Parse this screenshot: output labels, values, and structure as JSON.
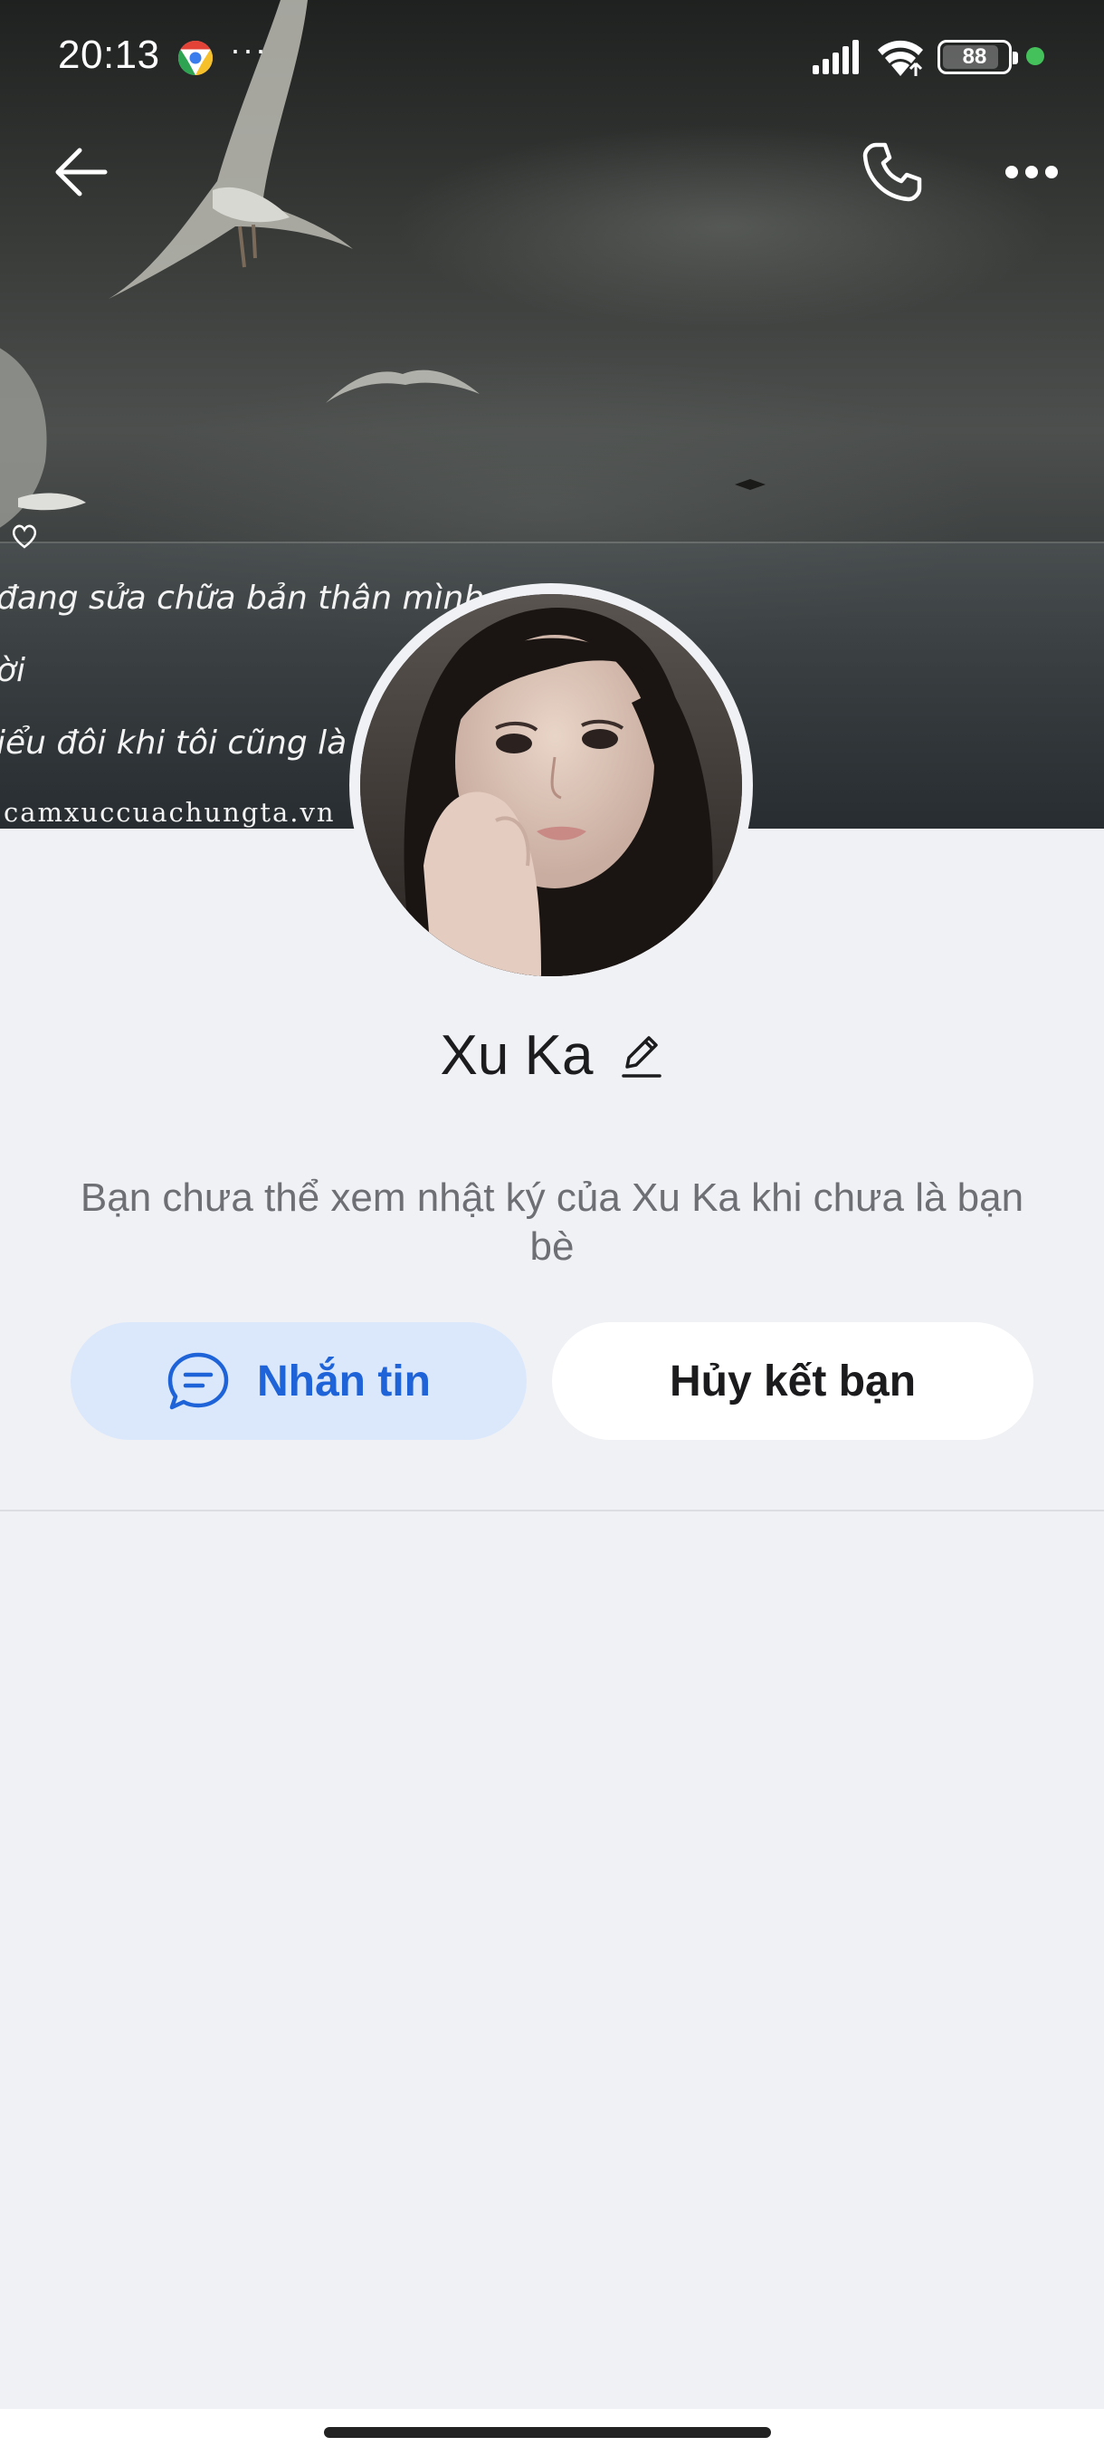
{
  "status_bar": {
    "time": "20:13",
    "more_indicator": "···",
    "battery_level": "88",
    "battery_fraction": 0.88,
    "icons": [
      "chrome-icon",
      "signal-icon",
      "wifi-icon",
      "battery-icon",
      "green-dot"
    ]
  },
  "top_nav": {
    "icons": [
      "back-arrow-icon",
      "phone-call-icon",
      "more-horizontal-icon"
    ]
  },
  "cover": {
    "lines": [
      "đang sửa chữa bản thân mình,",
      "ời",
      "iểu đôi khi tôi cũng là mộ"
    ],
    "watermark": "camxuccuachungta.vn"
  },
  "profile": {
    "name": "Xu Ka",
    "notice": "Bạn chưa thể xem nhật ký của Xu Ka khi chưa là bạn bè"
  },
  "actions": {
    "message_label": "Nhắn tin",
    "unfriend_label": "Hủy kết bạn"
  },
  "colors": {
    "accent": "#1f63d9",
    "accent_bg": "#dbe8fb",
    "page_bg": "#f0f1f5",
    "text_dark": "#1c1c1e",
    "text_muted": "#6d6f75"
  }
}
